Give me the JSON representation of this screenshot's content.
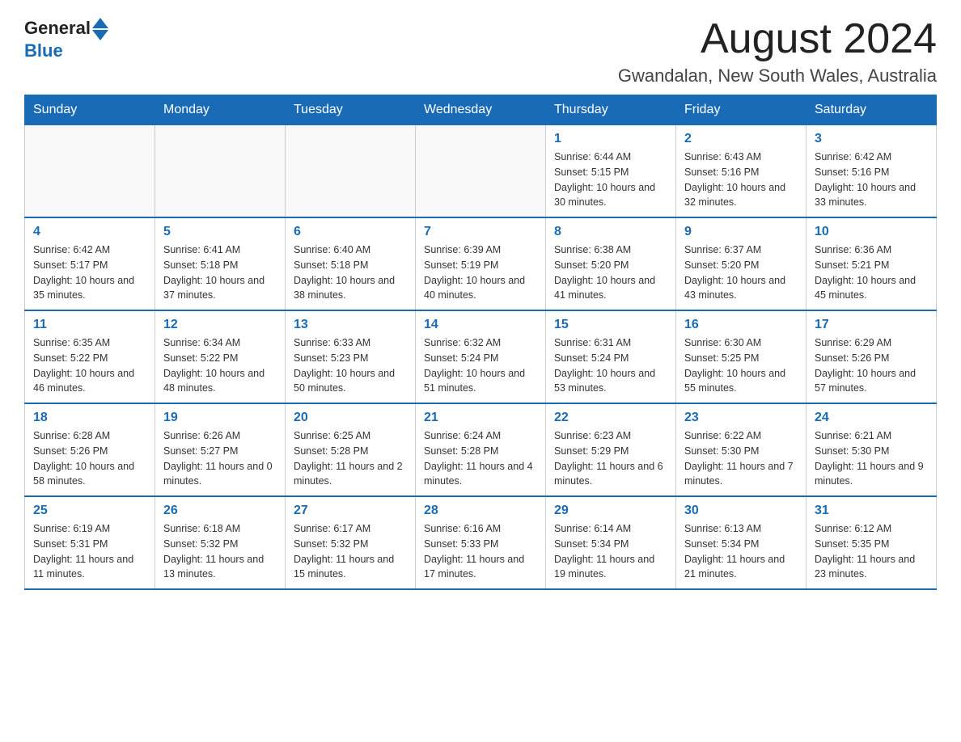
{
  "header": {
    "logo": {
      "general": "General",
      "blue": "Blue"
    },
    "title": "August 2024",
    "location": "Gwandalan, New South Wales, Australia"
  },
  "days_of_week": [
    "Sunday",
    "Monday",
    "Tuesday",
    "Wednesday",
    "Thursday",
    "Friday",
    "Saturday"
  ],
  "weeks": [
    [
      {
        "day": "",
        "info": ""
      },
      {
        "day": "",
        "info": ""
      },
      {
        "day": "",
        "info": ""
      },
      {
        "day": "",
        "info": ""
      },
      {
        "day": "1",
        "info": "Sunrise: 6:44 AM\nSunset: 5:15 PM\nDaylight: 10 hours and 30 minutes."
      },
      {
        "day": "2",
        "info": "Sunrise: 6:43 AM\nSunset: 5:16 PM\nDaylight: 10 hours and 32 minutes."
      },
      {
        "day": "3",
        "info": "Sunrise: 6:42 AM\nSunset: 5:16 PM\nDaylight: 10 hours and 33 minutes."
      }
    ],
    [
      {
        "day": "4",
        "info": "Sunrise: 6:42 AM\nSunset: 5:17 PM\nDaylight: 10 hours and 35 minutes."
      },
      {
        "day": "5",
        "info": "Sunrise: 6:41 AM\nSunset: 5:18 PM\nDaylight: 10 hours and 37 minutes."
      },
      {
        "day": "6",
        "info": "Sunrise: 6:40 AM\nSunset: 5:18 PM\nDaylight: 10 hours and 38 minutes."
      },
      {
        "day": "7",
        "info": "Sunrise: 6:39 AM\nSunset: 5:19 PM\nDaylight: 10 hours and 40 minutes."
      },
      {
        "day": "8",
        "info": "Sunrise: 6:38 AM\nSunset: 5:20 PM\nDaylight: 10 hours and 41 minutes."
      },
      {
        "day": "9",
        "info": "Sunrise: 6:37 AM\nSunset: 5:20 PM\nDaylight: 10 hours and 43 minutes."
      },
      {
        "day": "10",
        "info": "Sunrise: 6:36 AM\nSunset: 5:21 PM\nDaylight: 10 hours and 45 minutes."
      }
    ],
    [
      {
        "day": "11",
        "info": "Sunrise: 6:35 AM\nSunset: 5:22 PM\nDaylight: 10 hours and 46 minutes."
      },
      {
        "day": "12",
        "info": "Sunrise: 6:34 AM\nSunset: 5:22 PM\nDaylight: 10 hours and 48 minutes."
      },
      {
        "day": "13",
        "info": "Sunrise: 6:33 AM\nSunset: 5:23 PM\nDaylight: 10 hours and 50 minutes."
      },
      {
        "day": "14",
        "info": "Sunrise: 6:32 AM\nSunset: 5:24 PM\nDaylight: 10 hours and 51 minutes."
      },
      {
        "day": "15",
        "info": "Sunrise: 6:31 AM\nSunset: 5:24 PM\nDaylight: 10 hours and 53 minutes."
      },
      {
        "day": "16",
        "info": "Sunrise: 6:30 AM\nSunset: 5:25 PM\nDaylight: 10 hours and 55 minutes."
      },
      {
        "day": "17",
        "info": "Sunrise: 6:29 AM\nSunset: 5:26 PM\nDaylight: 10 hours and 57 minutes."
      }
    ],
    [
      {
        "day": "18",
        "info": "Sunrise: 6:28 AM\nSunset: 5:26 PM\nDaylight: 10 hours and 58 minutes."
      },
      {
        "day": "19",
        "info": "Sunrise: 6:26 AM\nSunset: 5:27 PM\nDaylight: 11 hours and 0 minutes."
      },
      {
        "day": "20",
        "info": "Sunrise: 6:25 AM\nSunset: 5:28 PM\nDaylight: 11 hours and 2 minutes."
      },
      {
        "day": "21",
        "info": "Sunrise: 6:24 AM\nSunset: 5:28 PM\nDaylight: 11 hours and 4 minutes."
      },
      {
        "day": "22",
        "info": "Sunrise: 6:23 AM\nSunset: 5:29 PM\nDaylight: 11 hours and 6 minutes."
      },
      {
        "day": "23",
        "info": "Sunrise: 6:22 AM\nSunset: 5:30 PM\nDaylight: 11 hours and 7 minutes."
      },
      {
        "day": "24",
        "info": "Sunrise: 6:21 AM\nSunset: 5:30 PM\nDaylight: 11 hours and 9 minutes."
      }
    ],
    [
      {
        "day": "25",
        "info": "Sunrise: 6:19 AM\nSunset: 5:31 PM\nDaylight: 11 hours and 11 minutes."
      },
      {
        "day": "26",
        "info": "Sunrise: 6:18 AM\nSunset: 5:32 PM\nDaylight: 11 hours and 13 minutes."
      },
      {
        "day": "27",
        "info": "Sunrise: 6:17 AM\nSunset: 5:32 PM\nDaylight: 11 hours and 15 minutes."
      },
      {
        "day": "28",
        "info": "Sunrise: 6:16 AM\nSunset: 5:33 PM\nDaylight: 11 hours and 17 minutes."
      },
      {
        "day": "29",
        "info": "Sunrise: 6:14 AM\nSunset: 5:34 PM\nDaylight: 11 hours and 19 minutes."
      },
      {
        "day": "30",
        "info": "Sunrise: 6:13 AM\nSunset: 5:34 PM\nDaylight: 11 hours and 21 minutes."
      },
      {
        "day": "31",
        "info": "Sunrise: 6:12 AM\nSunset: 5:35 PM\nDaylight: 11 hours and 23 minutes."
      }
    ]
  ]
}
